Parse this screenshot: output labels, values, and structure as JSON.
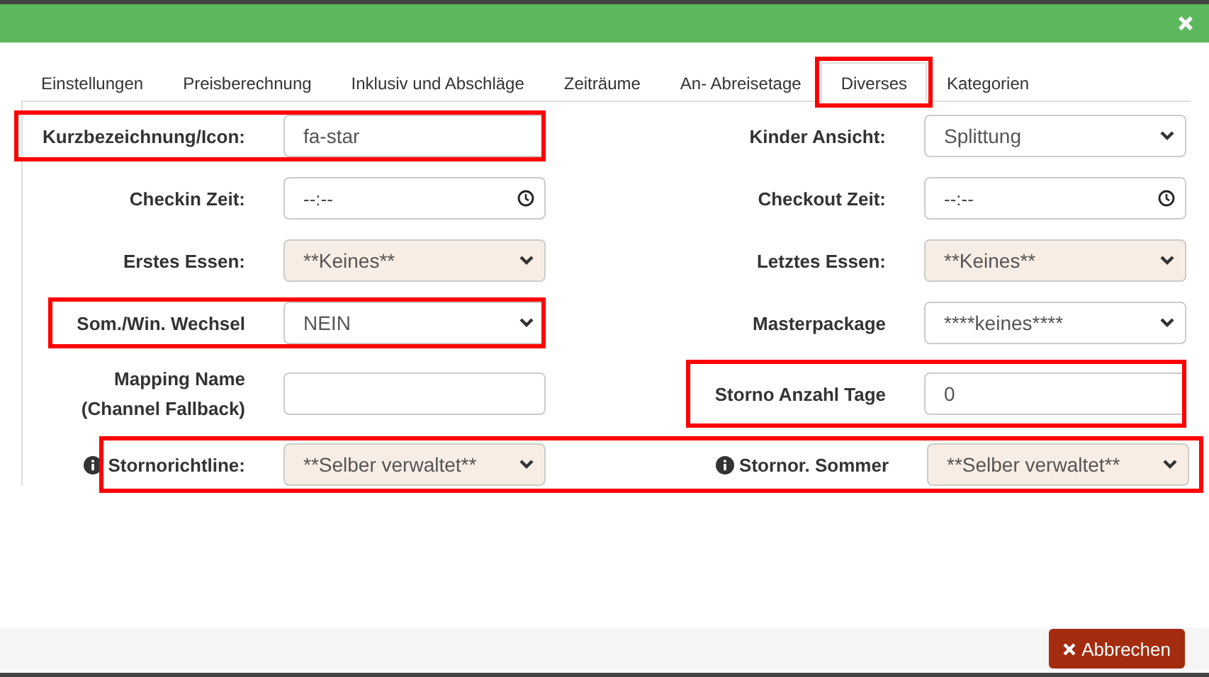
{
  "tabs": [
    {
      "label": "Einstellungen",
      "selected": false,
      "highlighted": false
    },
    {
      "label": "Preisberechnung",
      "selected": false,
      "highlighted": false
    },
    {
      "label": "Inklusiv und Abschläge",
      "selected": false,
      "highlighted": false
    },
    {
      "label": "Zeiträume",
      "selected": false,
      "highlighted": false
    },
    {
      "label": "An- Abreisetage",
      "selected": false,
      "highlighted": false
    },
    {
      "label": "Diverses",
      "selected": true,
      "highlighted": true
    },
    {
      "label": "Kategorien",
      "selected": false,
      "highlighted": false
    }
  ],
  "rows": [
    {
      "highlighted": false,
      "fields": [
        {
          "label": "Kurzbezeichnung/Icon:",
          "kind": "text",
          "value": "fa-star",
          "disabled": false,
          "highlighted": true,
          "info": false
        },
        {
          "label": "Kinder Ansicht:",
          "kind": "select",
          "value": "Splittung",
          "disabled": false,
          "highlighted": false,
          "info": false
        }
      ]
    },
    {
      "highlighted": false,
      "fields": [
        {
          "label": "Checkin Zeit:",
          "kind": "time",
          "value": "--:--",
          "disabled": false,
          "highlighted": false,
          "info": false
        },
        {
          "label": "Checkout Zeit:",
          "kind": "time",
          "value": "--:--",
          "disabled": false,
          "highlighted": false,
          "info": false
        }
      ]
    },
    {
      "highlighted": false,
      "fields": [
        {
          "label": "Erstes Essen:",
          "kind": "select",
          "value": "**Keines**",
          "disabled": true,
          "highlighted": false,
          "info": false
        },
        {
          "label": "Letztes Essen:",
          "kind": "select",
          "value": "**Keines**",
          "disabled": true,
          "highlighted": false,
          "info": false
        }
      ]
    },
    {
      "highlighted": false,
      "fields": [
        {
          "label": "Som./Win. Wechsel",
          "kind": "select",
          "value": "NEIN",
          "disabled": false,
          "highlighted": true,
          "info": false
        },
        {
          "label": "Masterpackage",
          "kind": "select",
          "value": "****keines****",
          "disabled": false,
          "highlighted": false,
          "info": false
        }
      ]
    },
    {
      "highlighted": false,
      "fields": [
        {
          "label": "Mapping Name (Channel Fallback)",
          "kind": "text",
          "disabled": false,
          "highlighted": false,
          "info": false
        },
        {
          "label": "Storno Anzahl Tage",
          "kind": "text",
          "value": "0",
          "disabled": false,
          "highlighted": true,
          "info": false
        }
      ]
    },
    {
      "highlighted": true,
      "fields": [
        {
          "label": "Stornorichtline:",
          "kind": "select",
          "value": "**Selber verwaltet**",
          "disabled": true,
          "highlighted": false,
          "info": true
        },
        {
          "label": "Stornor. Sommer",
          "kind": "select",
          "value": "**Selber verwaltet**",
          "disabled": true,
          "highlighted": false,
          "info": true
        }
      ]
    }
  ],
  "footer": {
    "cancel_button": "Abbrechen"
  }
}
